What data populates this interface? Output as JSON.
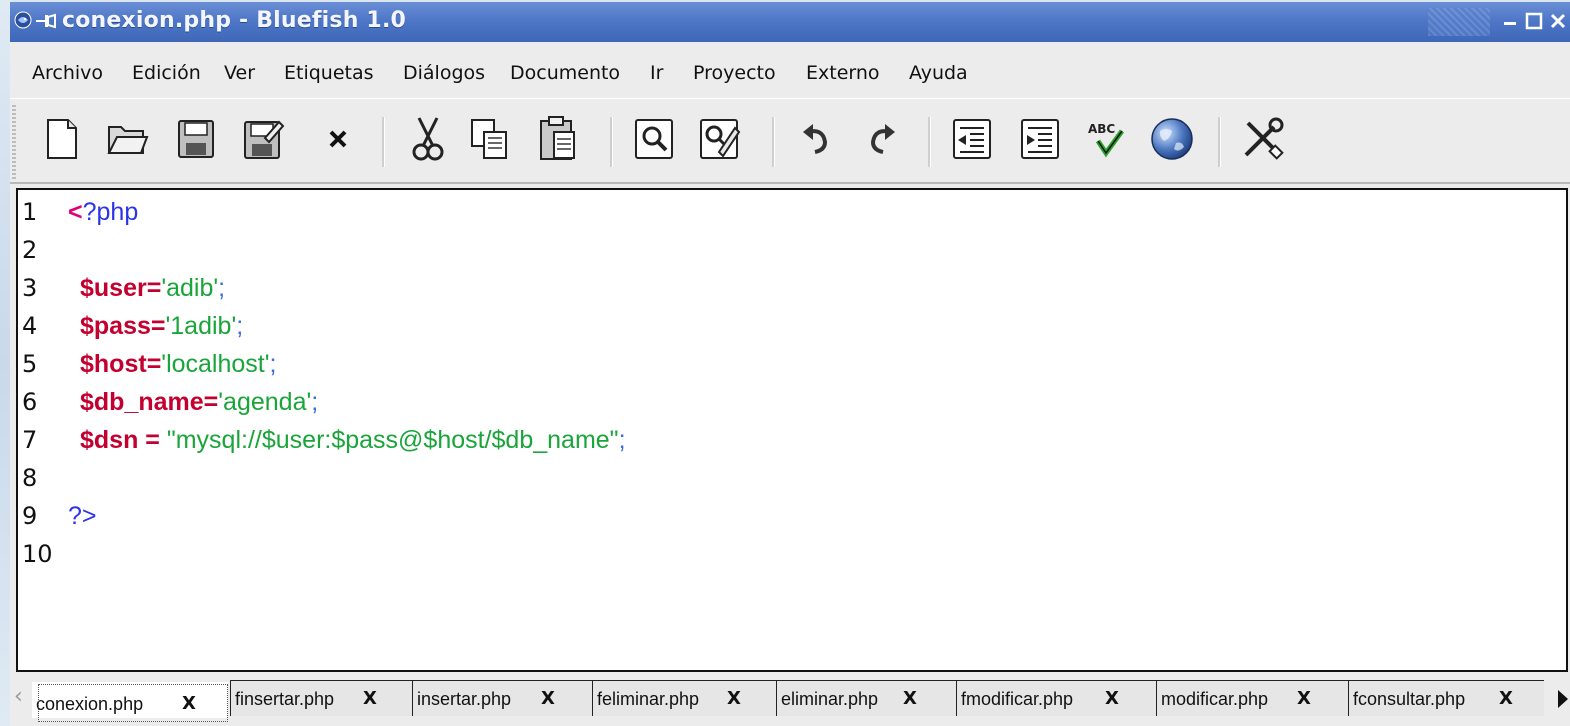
{
  "window": {
    "title": "conexion.php - Bluefish 1.0"
  },
  "menu": {
    "items": [
      "Archivo",
      "Edición",
      "Ver",
      "Etiquetas",
      "Diálogos",
      "Documento",
      "Ir",
      "Proyecto",
      "Externo",
      "Ayuda"
    ]
  },
  "toolbar": {
    "buttons": [
      "new-file-icon",
      "open-folder-icon",
      "save-icon",
      "save-as-icon",
      "close-icon",
      "cut-icon",
      "copy-icon",
      "paste-icon",
      "find-icon",
      "replace-icon",
      "undo-icon",
      "redo-icon",
      "unindent-icon",
      "indent-icon",
      "spellcheck-icon",
      "preview-browser-icon",
      "preferences-icon"
    ],
    "spellcheck_text": "ABC"
  },
  "editor": {
    "line_numbers": [
      "1",
      "2",
      "3",
      "4",
      "5",
      "6",
      "7",
      "8",
      "9",
      "10"
    ],
    "lines": {
      "l1": {
        "open": "<",
        "rest": "?php"
      },
      "l3": {
        "var": "$user",
        "eq": "=",
        "str": "'adib'",
        "end": ";"
      },
      "l4": {
        "var": "$pass",
        "eq": "=",
        "str": "'1adib'",
        "end": ";"
      },
      "l5": {
        "var": "$host",
        "eq": "=",
        "str": "'localhost'",
        "end": ";"
      },
      "l6": {
        "var": "$db_name",
        "eq": "=",
        "str": "'agenda'",
        "end": ";"
      },
      "l7": {
        "var": "$dsn",
        "eq": " = ",
        "str": "\"mysql://$user:$pass@$host/$db_name\"",
        "end": ";"
      },
      "l9": {
        "close": "?>"
      }
    }
  },
  "tabs": {
    "close_glyph": "X",
    "items": [
      "conexion.php",
      "finsertar.php",
      "insertar.php",
      "feliminar.php",
      "eliminar.php",
      "fmodificar.php",
      "modificar.php",
      "fconsultar.php"
    ],
    "active": "conexion.php"
  },
  "colors": {
    "titlebar": "#4f77c7",
    "variable": "#c3002f",
    "string": "#1aa53a",
    "php_tag": "#e0007c"
  }
}
